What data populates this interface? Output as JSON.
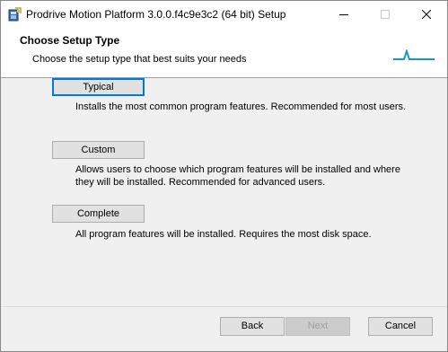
{
  "window": {
    "title": "Prodrive Motion Platform 3.0.0.f4c9e3c2 (64 bit) Setup"
  },
  "header": {
    "title": "Choose Setup Type",
    "subtitle": "Choose the setup type that best suits your needs"
  },
  "options": [
    {
      "label": "Typical",
      "description": "Installs the most common program features. Recommended for most users."
    },
    {
      "label": "Custom",
      "description": "Allows users to choose which program features will be installed and where they will be installed. Recommended for advanced users."
    },
    {
      "label": "Complete",
      "description": "All program features will be installed. Requires the most disk space."
    }
  ],
  "footer": {
    "back_label": "Back",
    "next_label": "Next",
    "next_enabled": false,
    "cancel_label": "Cancel"
  },
  "colors": {
    "accent": "#0078d7",
    "logo": "#1b94c8"
  },
  "icons": {
    "app": "installer-package-icon",
    "logo": "prodrive-wave-logo"
  }
}
